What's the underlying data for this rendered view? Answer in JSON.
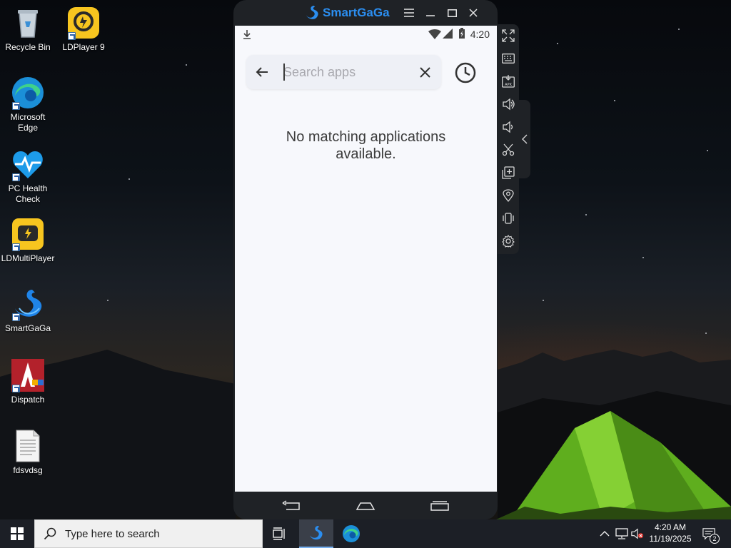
{
  "desktop": {
    "icons": [
      {
        "label": "Recycle Bin",
        "icon": "recycle-bin-icon"
      },
      {
        "label": "LDPlayer 9",
        "icon": "ldplayer-icon"
      },
      {
        "label": "Microsoft Edge",
        "icon": "edge-icon"
      },
      {
        "label": "PC Health Check",
        "icon": "pc-health-check-icon"
      },
      {
        "label": "LDMultiPlayer",
        "icon": "ldmultiplayer-icon"
      },
      {
        "label": "SmartGaGa",
        "icon": "smartgaga-icon"
      },
      {
        "label": "Dispatch",
        "icon": "dispatch-icon"
      },
      {
        "label": "fdsvdsg",
        "icon": "text-file-icon"
      }
    ]
  },
  "emulator": {
    "title": "SmartGaGa",
    "brand_color": "#2b8ef0",
    "window_controls": [
      "menu-icon",
      "minimize-icon",
      "maximize-icon",
      "close-icon"
    ],
    "side_toolbar": [
      "fullscreen-icon",
      "keyboard-icon",
      "apk-install-icon",
      "volume-up-icon",
      "volume-down-icon",
      "scissors-icon",
      "multi-instance-icon",
      "location-icon",
      "shake-icon",
      "settings-icon"
    ],
    "phone": {
      "status": {
        "time": "4:20"
      },
      "search": {
        "placeholder": "Search apps",
        "value": ""
      },
      "empty_message": "No matching applications available."
    },
    "nav_buttons": [
      "back-icon",
      "home-icon",
      "recents-icon"
    ]
  },
  "taskbar": {
    "search_placeholder": "Type here to search",
    "pinned": [
      "task-view-icon",
      "smartgaga-icon",
      "edge-icon"
    ],
    "active_app": "smartgaga-icon",
    "tray": {
      "time": "4:20 AM",
      "date": "11/19/2025",
      "notification_count": "2"
    }
  }
}
